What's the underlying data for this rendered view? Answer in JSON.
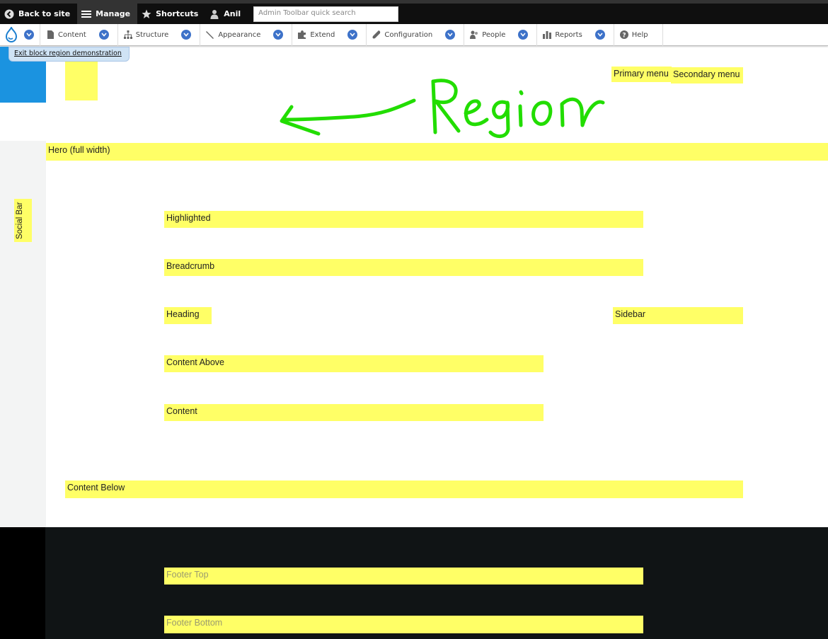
{
  "toolbar": {
    "back_to_site": "Back to site",
    "manage": "Manage",
    "shortcuts": "Shortcuts",
    "user": "Anil",
    "search_placeholder": "Admin Toolbar quick search"
  },
  "tray": {
    "items": [
      {
        "label": "Content",
        "icon": "content-icon"
      },
      {
        "label": "Structure",
        "icon": "structure-icon"
      },
      {
        "label": "Appearance",
        "icon": "appearance-icon"
      },
      {
        "label": "Extend",
        "icon": "extend-icon"
      },
      {
        "label": "Configuration",
        "icon": "configuration-icon"
      },
      {
        "label": "People",
        "icon": "people-icon"
      },
      {
        "label": "Reports",
        "icon": "reports-icon"
      },
      {
        "label": "Help",
        "icon": "help-icon"
      }
    ]
  },
  "exit_link": "Exit block region demonstration",
  "annotation": {
    "text": "Region",
    "color": "#22dd00"
  },
  "regions": {
    "primary_menu": "Primary menu",
    "secondary_menu": "Secondary menu",
    "hero": "Hero (full width)",
    "social_bar": "Social Bar",
    "highlighted": "Highlighted",
    "breadcrumb": "Breadcrumb",
    "heading": "Heading",
    "sidebar": "Sidebar",
    "content_above": "Content Above",
    "content": "Content",
    "content_below": "Content Below",
    "footer_top": "Footer Top",
    "footer_bottom": "Footer Bottom"
  },
  "colors": {
    "region_highlight": "#ffff66",
    "brand_blue": "#1b93e0",
    "footer_bg": "#101415"
  }
}
